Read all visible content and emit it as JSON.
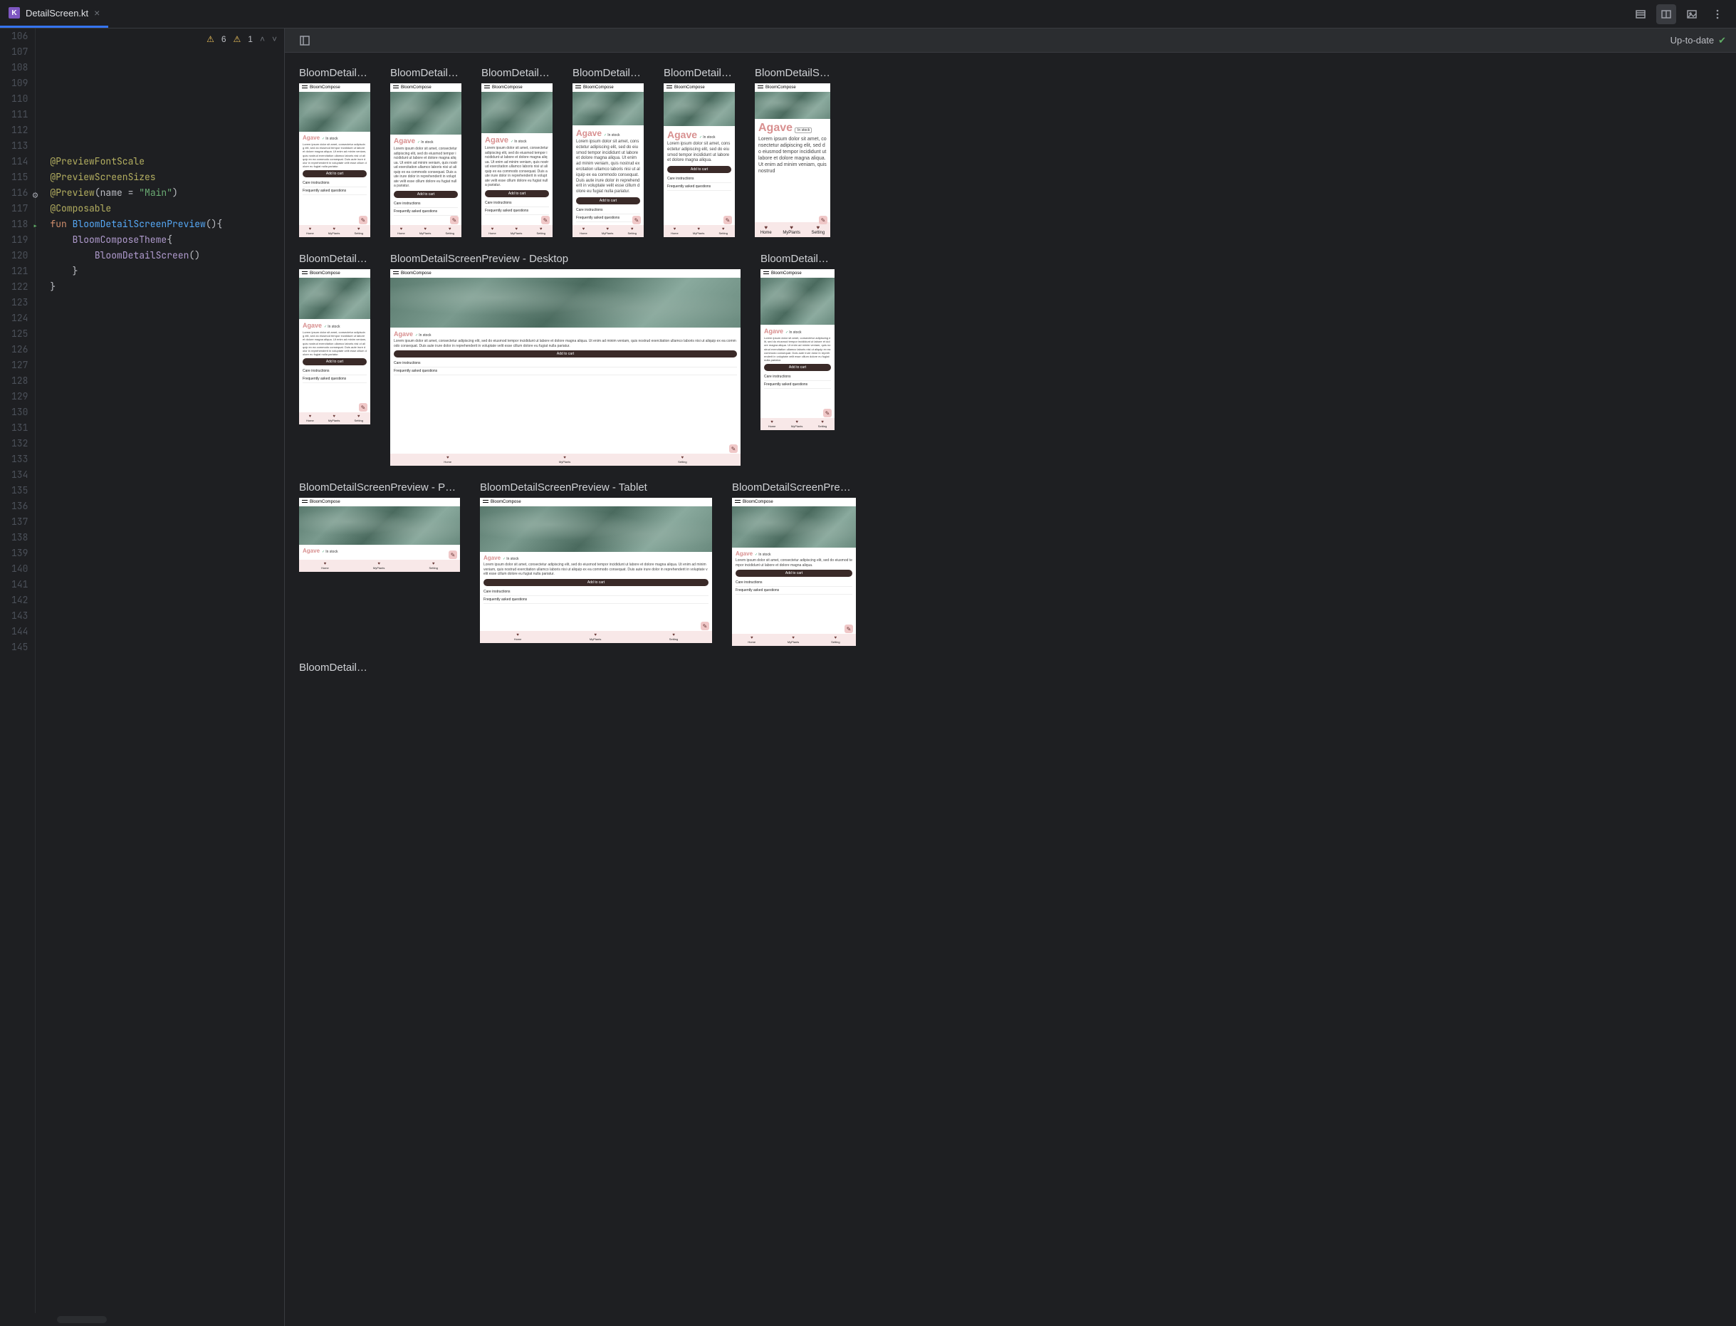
{
  "tab": {
    "filename": "DetailScreen.kt",
    "close": "×"
  },
  "toolbar": {
    "warnings": [
      {
        "icon": "⚠",
        "count": "6"
      },
      {
        "icon": "⚠",
        "count": "1"
      }
    ]
  },
  "gutter": {
    "start": 106,
    "end": 145,
    "markers": {
      "116": "gear",
      "118": "run"
    }
  },
  "code": {
    "lines": [
      {
        "n": 106,
        "t": []
      },
      {
        "n": 107,
        "t": []
      },
      {
        "n": 108,
        "t": []
      },
      {
        "n": 109,
        "t": []
      },
      {
        "n": 110,
        "t": []
      },
      {
        "n": 111,
        "t": []
      },
      {
        "n": 112,
        "t": []
      },
      {
        "n": 113,
        "t": []
      },
      {
        "n": 114,
        "t": [
          [
            "ann",
            "@PreviewFontScale"
          ]
        ]
      },
      {
        "n": 115,
        "t": [
          [
            "ann",
            "@PreviewScreenSizes"
          ]
        ]
      },
      {
        "n": 116,
        "t": [
          [
            "ann",
            "@Preview"
          ],
          [
            "p",
            "("
          ],
          [
            "type",
            "name = "
          ],
          [
            "str",
            "\"Main\""
          ],
          [
            "p",
            ")"
          ]
        ]
      },
      {
        "n": 117,
        "t": [
          [
            "ann",
            "@Composable"
          ]
        ]
      },
      {
        "n": 118,
        "t": [
          [
            "kw",
            "fun "
          ],
          [
            "fn",
            "BloomDetailScreenPreview"
          ],
          [
            "p",
            "(){"
          ]
        ]
      },
      {
        "n": 119,
        "t": [
          [
            "p",
            "    "
          ],
          [
            "call",
            "BloomComposeTheme"
          ],
          [
            "p",
            "{"
          ]
        ]
      },
      {
        "n": 120,
        "t": [
          [
            "p",
            "        "
          ],
          [
            "call",
            "BloomDetailScreen"
          ],
          [
            "p",
            "()"
          ]
        ]
      },
      {
        "n": 121,
        "t": [
          [
            "p",
            "    }"
          ]
        ]
      },
      {
        "n": 122,
        "t": [
          [
            "p",
            "}"
          ]
        ]
      },
      {
        "n": 123,
        "t": []
      },
      {
        "n": 124,
        "t": []
      },
      {
        "n": 125,
        "t": []
      },
      {
        "n": 126,
        "t": []
      },
      {
        "n": 127,
        "t": []
      },
      {
        "n": 128,
        "t": []
      },
      {
        "n": 129,
        "t": []
      },
      {
        "n": 130,
        "t": []
      },
      {
        "n": 131,
        "t": []
      },
      {
        "n": 132,
        "t": []
      },
      {
        "n": 133,
        "t": []
      },
      {
        "n": 134,
        "t": []
      },
      {
        "n": 135,
        "t": []
      },
      {
        "n": 136,
        "t": []
      },
      {
        "n": 137,
        "t": []
      },
      {
        "n": 138,
        "t": []
      },
      {
        "n": 139,
        "t": []
      },
      {
        "n": 140,
        "t": []
      },
      {
        "n": 141,
        "t": []
      },
      {
        "n": 142,
        "t": []
      },
      {
        "n": 143,
        "t": []
      },
      {
        "n": 144,
        "t": []
      },
      {
        "n": 145,
        "t": []
      }
    ]
  },
  "preview": {
    "status": "Up-to-date",
    "app_title": "BloomCompose",
    "plant": "Agave",
    "stock": "In stock",
    "lorem_short": "Lorem ipsum dolor sit amet, consectetur adipiscing elit, sed do eiusmod tempor incididunt ut labore et dolore magna aliqua.",
    "lorem_long": "Lorem ipsum dolor sit amet, consectetur adipiscing elit, sed do eiusmod tempor incididunt ut labore et dolore magna aliqua. Ut enim ad minim veniam, quis nostrud exercitation ullamco laboris nisi ut aliquip ex ea commodo consequat. Duis aute irure dolor in reprehenderit in voluptate velit esse cillum dolore eu fugiat nulla pariatur.",
    "lorem_largest": "Lorem ipsum dolor sit amet, consectetur adipiscing elit, sed do eiusmod tempor incididunt ut labore et dolore magna aliqua. Ut enim ad minim veniam, quis nostrud",
    "add_cart": "Add to cart",
    "care": "Care instructions",
    "faq": "Frequently asked questions",
    "nav": {
      "home": "Home",
      "myplants": "MyPlants",
      "settings": "Setting"
    },
    "fab": "✎",
    "rows": [
      {
        "items": [
          {
            "title": "BloomDetailSc…",
            "variant": "sz-1",
            "desc": "long",
            "title_w": 100
          },
          {
            "title": "BloomDetailSc…",
            "variant": "sz-2",
            "desc": "long",
            "title_w": 100
          },
          {
            "title": "BloomDetailSc…",
            "variant": "sz-3",
            "desc": "long",
            "title_w": 100
          },
          {
            "title": "BloomDetailSc…",
            "variant": "sz-4",
            "desc": "long",
            "title_w": 100
          },
          {
            "title": "BloomDetailSc…",
            "variant": "sz-5",
            "desc": "short",
            "title_w": 100
          },
          {
            "title": "BloomDetailSc…",
            "variant": "sz-6",
            "desc": "largest",
            "title_w": 106
          }
        ]
      },
      {
        "items": [
          {
            "title": "BloomDetailSc…",
            "variant": "sz-main",
            "desc": "long",
            "title_w": 100
          },
          {
            "title": "BloomDetailScreenPreview - Desktop",
            "variant": "sz-desktop",
            "desc": "long",
            "title_w": 492,
            "wide": true
          },
          {
            "title": "BloomDetailSc…",
            "variant": "sz-folded",
            "desc": "long",
            "title_w": 104
          }
        ]
      },
      {
        "items": [
          {
            "title": "BloomDetailScreenPreview - Pho…",
            "variant": "sz-phland",
            "desc": "none",
            "title_w": 226,
            "land": true
          },
          {
            "title": "BloomDetailScreenPreview - Tablet",
            "variant": "sz-tablet",
            "desc": "long",
            "title_w": 326,
            "wide": true
          },
          {
            "title": "BloomDetailScreenPrevie…",
            "variant": "sz-unfold",
            "desc": "short",
            "title_w": 174,
            "wide": true
          }
        ]
      },
      {
        "items": [
          {
            "title": "BloomDetailSc…",
            "variant": "none",
            "title_w": 100
          }
        ]
      }
    ]
  }
}
